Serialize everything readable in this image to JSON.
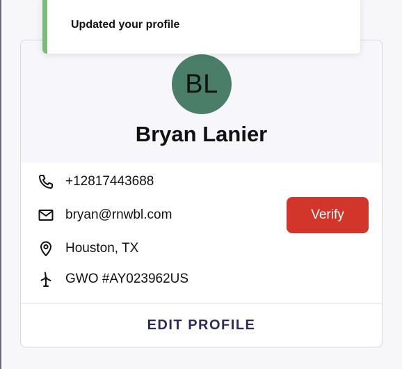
{
  "toast": {
    "message": "Updated your profile",
    "accent_color": "#7dbb7b"
  },
  "profile": {
    "initials": "BL",
    "avatar_color": "#4a7e68",
    "name": "Bryan Lanier",
    "phone": "+12817443688",
    "email": "bryan@rnwbl.com",
    "location": "Houston, TX",
    "gwo_id": "GWO #AY023962US",
    "icons": {
      "phone": "phone-icon",
      "email": "mail-icon",
      "location": "location-pin-icon",
      "gwo": "wind-turbine-icon"
    }
  },
  "actions": {
    "verify_label": "Verify",
    "verify_color": "#d2362b",
    "edit_profile_label": "EDIT PROFILE",
    "edit_profile_color": "#2d2a5e"
  }
}
